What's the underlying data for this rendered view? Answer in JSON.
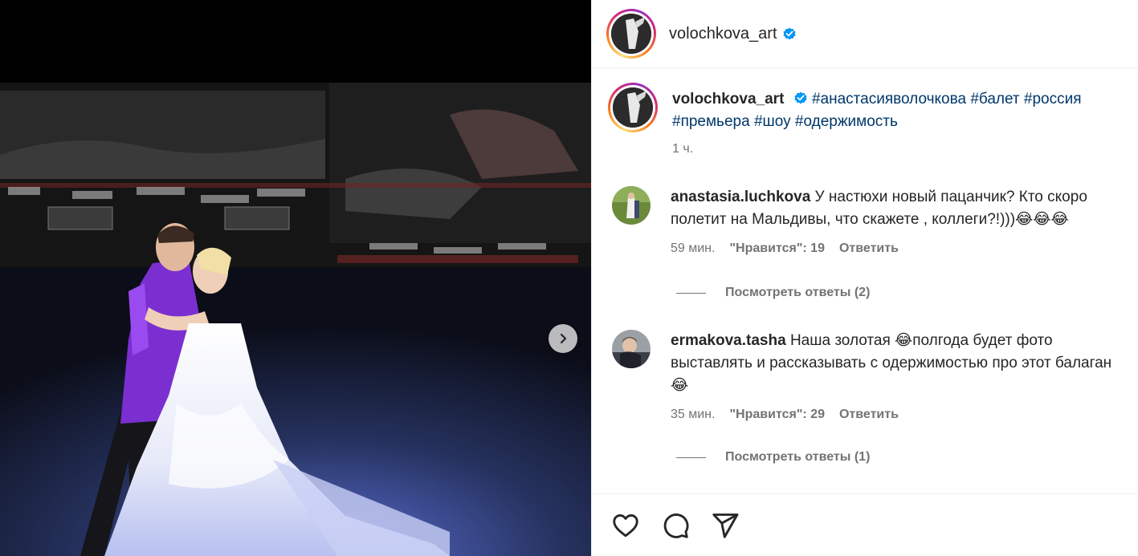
{
  "post": {
    "username": "volochkova_art",
    "verified": true,
    "caption": {
      "username": "volochkova_art",
      "hashtags": [
        "#анастасияволочкова",
        "#балет",
        "#россия",
        "#премьера",
        "#шоу",
        "#одержимость"
      ],
      "time": "1 ч."
    },
    "comments": [
      {
        "username": "anastasia.luchkova",
        "text": "У настюхи новый пацанчик? Кто скоро полетит на Мальдивы, что скажете , коллеги?!)))😂😂😂",
        "time": "59 мин.",
        "likes": "\"Нравится\": 19",
        "reply": "Ответить",
        "view_replies": "Посмотреть ответы (2)"
      },
      {
        "username": "ermakova.tasha",
        "text": "Наша золотая 😂полгода будет фото выставлять и рассказывать с одержимостью про этот балаган😂",
        "time": "35 мин.",
        "likes": "\"Нравится\": 29",
        "reply": "Ответить",
        "view_replies": "Посмотреть ответы (1)"
      }
    ]
  },
  "icons": {
    "like": "heart-icon",
    "comment": "comment-icon",
    "share": "share-icon",
    "next": "chevron-right-icon",
    "verified": "verified-badge-icon"
  },
  "colors": {
    "hashtag": "#00376b",
    "meta": "#737373",
    "verified": "#0095f6",
    "jacket": "#7b2fd1"
  }
}
